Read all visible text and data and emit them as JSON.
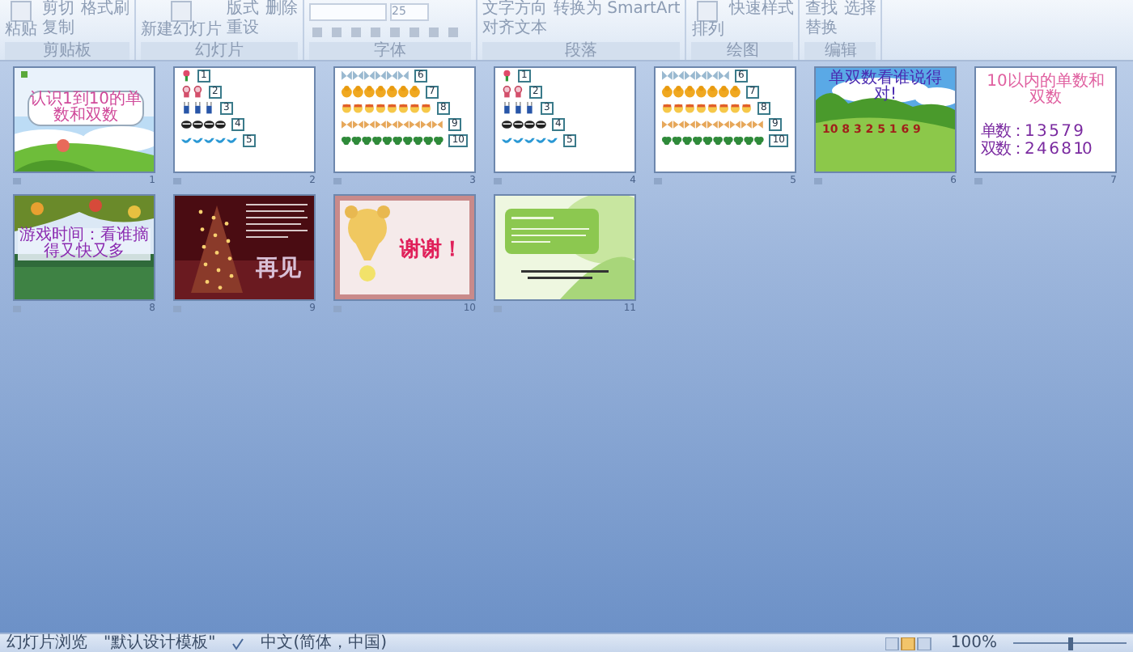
{
  "ribbon": {
    "groups": [
      {
        "label": "剪贴板",
        "large": "粘贴",
        "small": [
          "剪切",
          "复制",
          "格式刷"
        ]
      },
      {
        "label": "幻灯片",
        "large": "新建幻灯片",
        "small": [
          "版式",
          "重设",
          "删除"
        ]
      },
      {
        "label": "字体",
        "font_size": "25"
      },
      {
        "label": "段落",
        "small": [
          "文字方向",
          "对齐文本",
          "转换为 SmartArt"
        ]
      },
      {
        "label": "绘图",
        "large": "排列",
        "small": [
          "快速样式"
        ]
      },
      {
        "label": "编辑",
        "small": [
          "查找",
          "替换",
          "选择"
        ]
      }
    ]
  },
  "slides": [
    {
      "kind": "title",
      "number": "1",
      "title": "认识1到10的单数和双数"
    },
    {
      "kind": "counting",
      "number": "2",
      "rows": [
        {
          "label": "1",
          "kind": "flower"
        },
        {
          "label": "2",
          "kind": "doll"
        },
        {
          "label": "3",
          "kind": "rabbit"
        },
        {
          "label": "4",
          "kind": "bug"
        },
        {
          "label": "5",
          "kind": "bird"
        }
      ]
    },
    {
      "kind": "counting",
      "number": "3",
      "rows": [
        {
          "label": "6",
          "kind": "butterfly"
        },
        {
          "label": "7",
          "kind": "duck"
        },
        {
          "label": "8",
          "kind": "chick"
        },
        {
          "label": "9",
          "kind": "bow"
        },
        {
          "label": "10",
          "kind": "clover"
        }
      ]
    },
    {
      "kind": "counting",
      "number": "4",
      "rows": [
        {
          "label": "1",
          "kind": "flower"
        },
        {
          "label": "2",
          "kind": "doll"
        },
        {
          "label": "3",
          "kind": "rabbit"
        },
        {
          "label": "4",
          "kind": "bug"
        },
        {
          "label": "5",
          "kind": "bird"
        }
      ]
    },
    {
      "kind": "counting",
      "number": "5",
      "rows": [
        {
          "label": "6",
          "kind": "butterfly"
        },
        {
          "label": "7",
          "kind": "duck"
        },
        {
          "label": "8",
          "kind": "chick"
        },
        {
          "label": "9",
          "kind": "bow"
        },
        {
          "label": "10",
          "kind": "clover"
        }
      ]
    },
    {
      "kind": "numbers",
      "number": "6",
      "title": "单双数看谁说得对!",
      "digits": "10 8 3 2 5 1 6 9"
    },
    {
      "kind": "list",
      "number": "7",
      "title": "10以内的单数和双数",
      "lines": [
        "单数：1 3 5 7 9",
        "双数：2 4 6 8 10"
      ]
    },
    {
      "number": "8",
      "title": "游戏时间：看谁摘得又快又多"
    },
    {
      "kind": "farewell",
      "number": "9",
      "title": "再见"
    },
    {
      "kind": "thanks",
      "number": "10",
      "title": "谢谢！"
    },
    {
      "kind": "note",
      "number": "11"
    }
  ],
  "status_bar": {
    "view": "幻灯片浏览",
    "theme": "\"默认设计模板\"",
    "language": "中文(简体，中国)",
    "zoom": "100%",
    "zoom_slider": {
      "level": 0.5
    }
  }
}
